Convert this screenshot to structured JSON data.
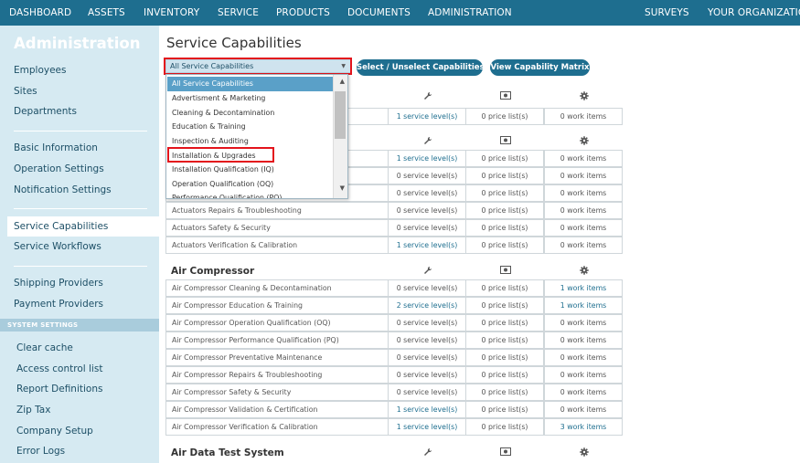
{
  "nav": {
    "left": [
      "DASHBOARD",
      "ASSETS",
      "INVENTORY",
      "SERVICE",
      "PRODUCTS",
      "DOCUMENTS",
      "ADMINISTRATION"
    ],
    "right": [
      "SURVEYS",
      "YOUR ORGANIZATION"
    ]
  },
  "sidebar": {
    "title": "Administration",
    "group1": [
      "Employees",
      "Sites",
      "Departments"
    ],
    "group2": [
      "Basic Information",
      "Operation Settings",
      "Notification Settings"
    ],
    "group3": [
      "Service Capabilities",
      "Service Workflows"
    ],
    "active": "Service Capabilities",
    "group4": [
      "Shipping Providers",
      "Payment Providers"
    ],
    "system_settings_label": "SYSTEM SETTINGS",
    "system": [
      "Clear cache",
      "Access control list",
      "Report Definitions",
      "Zip Tax",
      "Company Setup",
      "Error Logs"
    ]
  },
  "main": {
    "title": "Service Capabilities",
    "filter": {
      "selected": "All Service Capabilities",
      "options": [
        "All Service Capabilities",
        "Advertisment & Marketing",
        "Cleaning & Decontamination",
        "Education & Training",
        "Inspection & Auditing",
        "Installation & Upgrades",
        "Installation Qualification (IQ)",
        "Operation Qualification (OQ)",
        "Performance Qualification (PQ)"
      ],
      "highlighted_option": "Installation & Upgrades"
    },
    "buttons": {
      "select_unselect": "Select / Unselect Capabilities",
      "view_matrix": "View Capability Matrix"
    },
    "column_icons": [
      "wrench-icon",
      "money-icon",
      "gear-icon"
    ],
    "group_a": {
      "rows": [
        [
          "",
          "1 service level(s)",
          "0 price list(s)",
          "0 work items"
        ]
      ]
    },
    "group_b": {
      "rows": [
        [
          "",
          "1 service level(s)",
          "0 price list(s)",
          "0 work items"
        ],
        [
          "",
          "0 service level(s)",
          "0 price list(s)",
          "0 work items"
        ],
        [
          "",
          "0 service level(s)",
          "0 price list(s)",
          "0 work items"
        ],
        [
          "Actuators Repairs & Troubleshooting",
          "0 service level(s)",
          "0 price list(s)",
          "0 work items"
        ],
        [
          "Actuators Safety & Security",
          "0 service level(s)",
          "0 price list(s)",
          "0 work items"
        ],
        [
          "Actuators Verification & Calibration",
          "1 service level(s)",
          "0 price list(s)",
          "0 work items"
        ]
      ]
    },
    "air_compressor": {
      "title": "Air Compressor",
      "rows": [
        [
          "Air Compressor Cleaning & Decontamination",
          "0 service level(s)",
          "0 price list(s)",
          "1 work items"
        ],
        [
          "Air Compressor Education & Training",
          "2 service level(s)",
          "0 price list(s)",
          "1 work items"
        ],
        [
          "Air Compressor Operation Qualification (OQ)",
          "0 service level(s)",
          "0 price list(s)",
          "0 work items"
        ],
        [
          "Air Compressor Performance Qualification (PQ)",
          "0 service level(s)",
          "0 price list(s)",
          "0 work items"
        ],
        [
          "Air Compressor Preventative Maintenance",
          "0 service level(s)",
          "0 price list(s)",
          "0 work items"
        ],
        [
          "Air Compressor Repairs & Troubleshooting",
          "0 service level(s)",
          "0 price list(s)",
          "0 work items"
        ],
        [
          "Air Compressor Safety & Security",
          "0 service level(s)",
          "0 price list(s)",
          "0 work items"
        ],
        [
          "Air Compressor Validation & Certification",
          "1 service level(s)",
          "0 price list(s)",
          "0 work items"
        ],
        [
          "Air Compressor Verification & Calibration",
          "1 service level(s)",
          "0 price list(s)",
          "3 work items"
        ]
      ]
    },
    "air_data": {
      "title": "Air Data Test System"
    }
  },
  "colors": {
    "nav_bg": "#1e6e8f",
    "sidebar_bg": "#d6eaf2",
    "highlight": "#e3141c",
    "link": "#1e6e8f"
  }
}
